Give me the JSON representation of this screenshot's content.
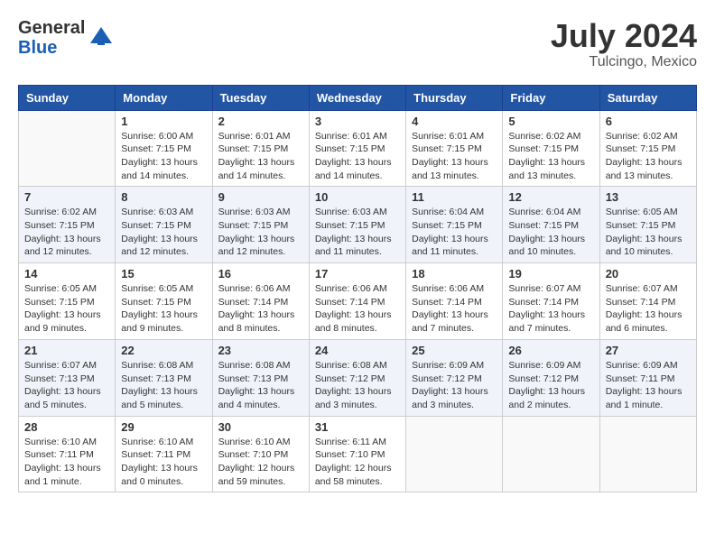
{
  "logo": {
    "general": "General",
    "blue": "Blue"
  },
  "title": {
    "month": "July 2024",
    "location": "Tulcingo, Mexico"
  },
  "headers": [
    "Sunday",
    "Monday",
    "Tuesday",
    "Wednesday",
    "Thursday",
    "Friday",
    "Saturday"
  ],
  "weeks": [
    [
      {
        "day": "",
        "sunrise": "",
        "sunset": "",
        "daylight": ""
      },
      {
        "day": "1",
        "sunrise": "Sunrise: 6:00 AM",
        "sunset": "Sunset: 7:15 PM",
        "daylight": "Daylight: 13 hours and 14 minutes."
      },
      {
        "day": "2",
        "sunrise": "Sunrise: 6:01 AM",
        "sunset": "Sunset: 7:15 PM",
        "daylight": "Daylight: 13 hours and 14 minutes."
      },
      {
        "day": "3",
        "sunrise": "Sunrise: 6:01 AM",
        "sunset": "Sunset: 7:15 PM",
        "daylight": "Daylight: 13 hours and 14 minutes."
      },
      {
        "day": "4",
        "sunrise": "Sunrise: 6:01 AM",
        "sunset": "Sunset: 7:15 PM",
        "daylight": "Daylight: 13 hours and 13 minutes."
      },
      {
        "day": "5",
        "sunrise": "Sunrise: 6:02 AM",
        "sunset": "Sunset: 7:15 PM",
        "daylight": "Daylight: 13 hours and 13 minutes."
      },
      {
        "day": "6",
        "sunrise": "Sunrise: 6:02 AM",
        "sunset": "Sunset: 7:15 PM",
        "daylight": "Daylight: 13 hours and 13 minutes."
      }
    ],
    [
      {
        "day": "7",
        "sunrise": "Sunrise: 6:02 AM",
        "sunset": "Sunset: 7:15 PM",
        "daylight": "Daylight: 13 hours and 12 minutes."
      },
      {
        "day": "8",
        "sunrise": "Sunrise: 6:03 AM",
        "sunset": "Sunset: 7:15 PM",
        "daylight": "Daylight: 13 hours and 12 minutes."
      },
      {
        "day": "9",
        "sunrise": "Sunrise: 6:03 AM",
        "sunset": "Sunset: 7:15 PM",
        "daylight": "Daylight: 13 hours and 12 minutes."
      },
      {
        "day": "10",
        "sunrise": "Sunrise: 6:03 AM",
        "sunset": "Sunset: 7:15 PM",
        "daylight": "Daylight: 13 hours and 11 minutes."
      },
      {
        "day": "11",
        "sunrise": "Sunrise: 6:04 AM",
        "sunset": "Sunset: 7:15 PM",
        "daylight": "Daylight: 13 hours and 11 minutes."
      },
      {
        "day": "12",
        "sunrise": "Sunrise: 6:04 AM",
        "sunset": "Sunset: 7:15 PM",
        "daylight": "Daylight: 13 hours and 10 minutes."
      },
      {
        "day": "13",
        "sunrise": "Sunrise: 6:05 AM",
        "sunset": "Sunset: 7:15 PM",
        "daylight": "Daylight: 13 hours and 10 minutes."
      }
    ],
    [
      {
        "day": "14",
        "sunrise": "Sunrise: 6:05 AM",
        "sunset": "Sunset: 7:15 PM",
        "daylight": "Daylight: 13 hours and 9 minutes."
      },
      {
        "day": "15",
        "sunrise": "Sunrise: 6:05 AM",
        "sunset": "Sunset: 7:15 PM",
        "daylight": "Daylight: 13 hours and 9 minutes."
      },
      {
        "day": "16",
        "sunrise": "Sunrise: 6:06 AM",
        "sunset": "Sunset: 7:14 PM",
        "daylight": "Daylight: 13 hours and 8 minutes."
      },
      {
        "day": "17",
        "sunrise": "Sunrise: 6:06 AM",
        "sunset": "Sunset: 7:14 PM",
        "daylight": "Daylight: 13 hours and 8 minutes."
      },
      {
        "day": "18",
        "sunrise": "Sunrise: 6:06 AM",
        "sunset": "Sunset: 7:14 PM",
        "daylight": "Daylight: 13 hours and 7 minutes."
      },
      {
        "day": "19",
        "sunrise": "Sunrise: 6:07 AM",
        "sunset": "Sunset: 7:14 PM",
        "daylight": "Daylight: 13 hours and 7 minutes."
      },
      {
        "day": "20",
        "sunrise": "Sunrise: 6:07 AM",
        "sunset": "Sunset: 7:14 PM",
        "daylight": "Daylight: 13 hours and 6 minutes."
      }
    ],
    [
      {
        "day": "21",
        "sunrise": "Sunrise: 6:07 AM",
        "sunset": "Sunset: 7:13 PM",
        "daylight": "Daylight: 13 hours and 5 minutes."
      },
      {
        "day": "22",
        "sunrise": "Sunrise: 6:08 AM",
        "sunset": "Sunset: 7:13 PM",
        "daylight": "Daylight: 13 hours and 5 minutes."
      },
      {
        "day": "23",
        "sunrise": "Sunrise: 6:08 AM",
        "sunset": "Sunset: 7:13 PM",
        "daylight": "Daylight: 13 hours and 4 minutes."
      },
      {
        "day": "24",
        "sunrise": "Sunrise: 6:08 AM",
        "sunset": "Sunset: 7:12 PM",
        "daylight": "Daylight: 13 hours and 3 minutes."
      },
      {
        "day": "25",
        "sunrise": "Sunrise: 6:09 AM",
        "sunset": "Sunset: 7:12 PM",
        "daylight": "Daylight: 13 hours and 3 minutes."
      },
      {
        "day": "26",
        "sunrise": "Sunrise: 6:09 AM",
        "sunset": "Sunset: 7:12 PM",
        "daylight": "Daylight: 13 hours and 2 minutes."
      },
      {
        "day": "27",
        "sunrise": "Sunrise: 6:09 AM",
        "sunset": "Sunset: 7:11 PM",
        "daylight": "Daylight: 13 hours and 1 minute."
      }
    ],
    [
      {
        "day": "28",
        "sunrise": "Sunrise: 6:10 AM",
        "sunset": "Sunset: 7:11 PM",
        "daylight": "Daylight: 13 hours and 1 minute."
      },
      {
        "day": "29",
        "sunrise": "Sunrise: 6:10 AM",
        "sunset": "Sunset: 7:11 PM",
        "daylight": "Daylight: 13 hours and 0 minutes."
      },
      {
        "day": "30",
        "sunrise": "Sunrise: 6:10 AM",
        "sunset": "Sunset: 7:10 PM",
        "daylight": "Daylight: 12 hours and 59 minutes."
      },
      {
        "day": "31",
        "sunrise": "Sunrise: 6:11 AM",
        "sunset": "Sunset: 7:10 PM",
        "daylight": "Daylight: 12 hours and 58 minutes."
      },
      {
        "day": "",
        "sunrise": "",
        "sunset": "",
        "daylight": ""
      },
      {
        "day": "",
        "sunrise": "",
        "sunset": "",
        "daylight": ""
      },
      {
        "day": "",
        "sunrise": "",
        "sunset": "",
        "daylight": ""
      }
    ]
  ]
}
